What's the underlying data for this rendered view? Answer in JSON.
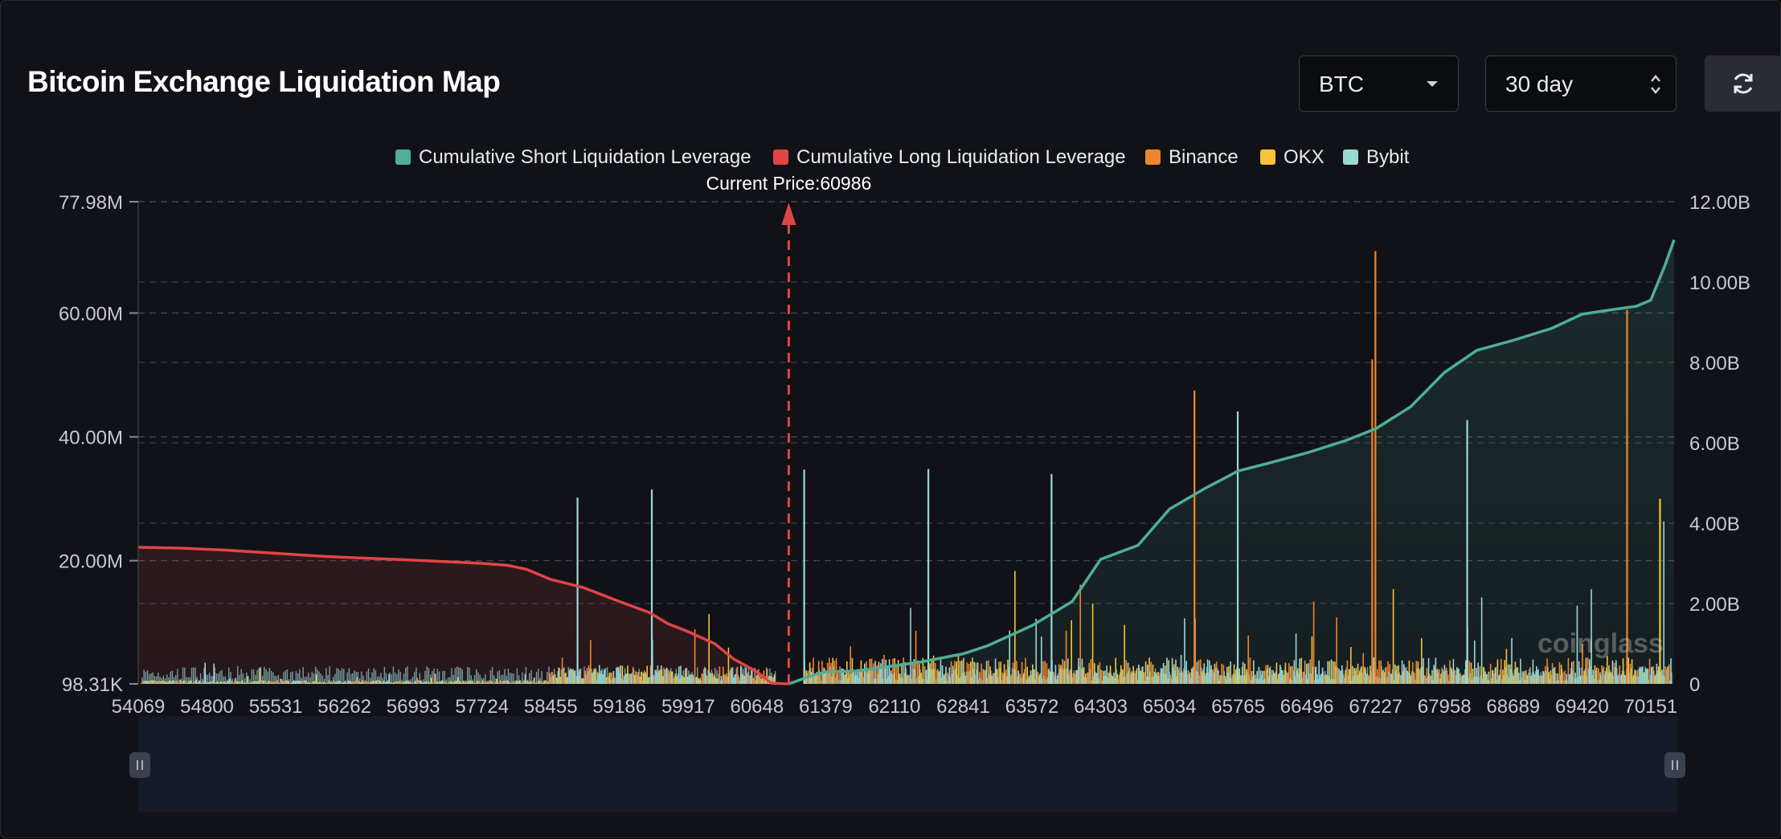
{
  "header": {
    "title": "Bitcoin Exchange Liquidation Map"
  },
  "controls": {
    "coin": "BTC",
    "period": "30 day",
    "refresh_icon": "refresh-icon"
  },
  "legend": [
    {
      "label": "Cumulative Short Liquidation Leverage",
      "color": "#4fae96"
    },
    {
      "label": "Cumulative Long Liquidation Leverage",
      "color": "#e04545"
    },
    {
      "label": "Binance",
      "color": "#f0852d"
    },
    {
      "label": "OKX",
      "color": "#f5c43a"
    },
    {
      "label": "Bybit",
      "color": "#9ad8d6"
    }
  ],
  "watermark": "coinglass",
  "chart_data": {
    "type": "bar",
    "current_price_label": "Current Price:60986",
    "current_price": 60986,
    "x_ticks": [
      "54069",
      "54800",
      "55531",
      "56262",
      "56993",
      "57724",
      "58455",
      "59186",
      "59917",
      "60648",
      "61379",
      "62110",
      "62841",
      "63572",
      "64303",
      "65034",
      "65765",
      "66496",
      "67227",
      "67958",
      "68689",
      "69420",
      "70151"
    ],
    "x_range": [
      54069,
      70400
    ],
    "y_left_ticks": [
      "98.31K",
      "20.00M",
      "40.00M",
      "60.00M",
      "77.98M"
    ],
    "y_left_range": [
      98310,
      77980000
    ],
    "y_right_ticks": [
      "0",
      "2.00B",
      "4.00B",
      "6.00B",
      "8.00B",
      "10.00B",
      "12.00B"
    ],
    "y_right_range": [
      0,
      12000000000
    ],
    "grid": "dashed horizontal",
    "legend_position": "top-center",
    "cumulative_long": {
      "name": "Cumulative Long Liquidation Leverage",
      "x": [
        54069,
        54500,
        55000,
        55531,
        56000,
        56262,
        56993,
        57724,
        58000,
        58200,
        58455,
        58800,
        59186,
        59500,
        59700,
        59917,
        60200,
        60400,
        60648,
        60800,
        60986
      ],
      "y": [
        3400000000.0,
        3380000000.0,
        3330000000.0,
        3250000000.0,
        3180000000.0,
        3150000000.0,
        3080000000.0,
        3000000000.0,
        2950000000.0,
        2850000000.0,
        2600000000.0,
        2400000000.0,
        2050000000.0,
        1780000000.0,
        1500000000.0,
        1300000000.0,
        1000000000.0,
        620000000.0,
        300000000.0,
        20000000.0,
        0
      ]
    },
    "cumulative_short": {
      "name": "Cumulative Short Liquidation Leverage",
      "x": [
        60986,
        61200,
        61379,
        61700,
        62110,
        62400,
        62841,
        63100,
        63572,
        64000,
        64303,
        64700,
        65034,
        65400,
        65765,
        66100,
        66496,
        66900,
        67227,
        67600,
        67958,
        68300,
        68689,
        69100,
        69420,
        69700,
        70000,
        70151,
        70300,
        70400
      ],
      "y": [
        0,
        180000000.0,
        300000000.0,
        320000000.0,
        450000000.0,
        550000000.0,
        750000000.0,
        950000000.0,
        1450000000.0,
        2050000000.0,
        3100000000.0,
        3450000000.0,
        4350000000.0,
        4850000000.0,
        5300000000.0,
        5500000000.0,
        5750000000.0,
        6050000000.0,
        6350000000.0,
        6900000000.0,
        7750000000.0,
        8300000000.0,
        8550000000.0,
        8850000000.0,
        9200000000.0,
        9300000000.0,
        9400000000.0,
        9550000000.0,
        10400000000.0,
        11050000000.0
      ]
    },
    "peaks": [
      {
        "x": 58740,
        "series": "Bybit",
        "y": 30200000
      },
      {
        "x": 59530,
        "series": "Bybit",
        "y": 31500000
      },
      {
        "x": 61150,
        "series": "Bybit",
        "y": 34700000
      },
      {
        "x": 62470,
        "series": "Bybit",
        "y": 34800000
      },
      {
        "x": 63780,
        "series": "Bybit",
        "y": 34000000
      },
      {
        "x": 65300,
        "series": "Binance",
        "y": 47500000
      },
      {
        "x": 65760,
        "series": "Bybit",
        "y": 44100000
      },
      {
        "x": 67224,
        "series": "Binance",
        "y": 70000000
      },
      {
        "x": 67190,
        "series": "Binance",
        "y": 52500000
      },
      {
        "x": 68200,
        "series": "Bybit",
        "y": 42700000
      },
      {
        "x": 69900,
        "series": "Binance",
        "y": 60500000
      },
      {
        "x": 70250,
        "series": "OKX",
        "y": 30000000
      }
    ]
  }
}
